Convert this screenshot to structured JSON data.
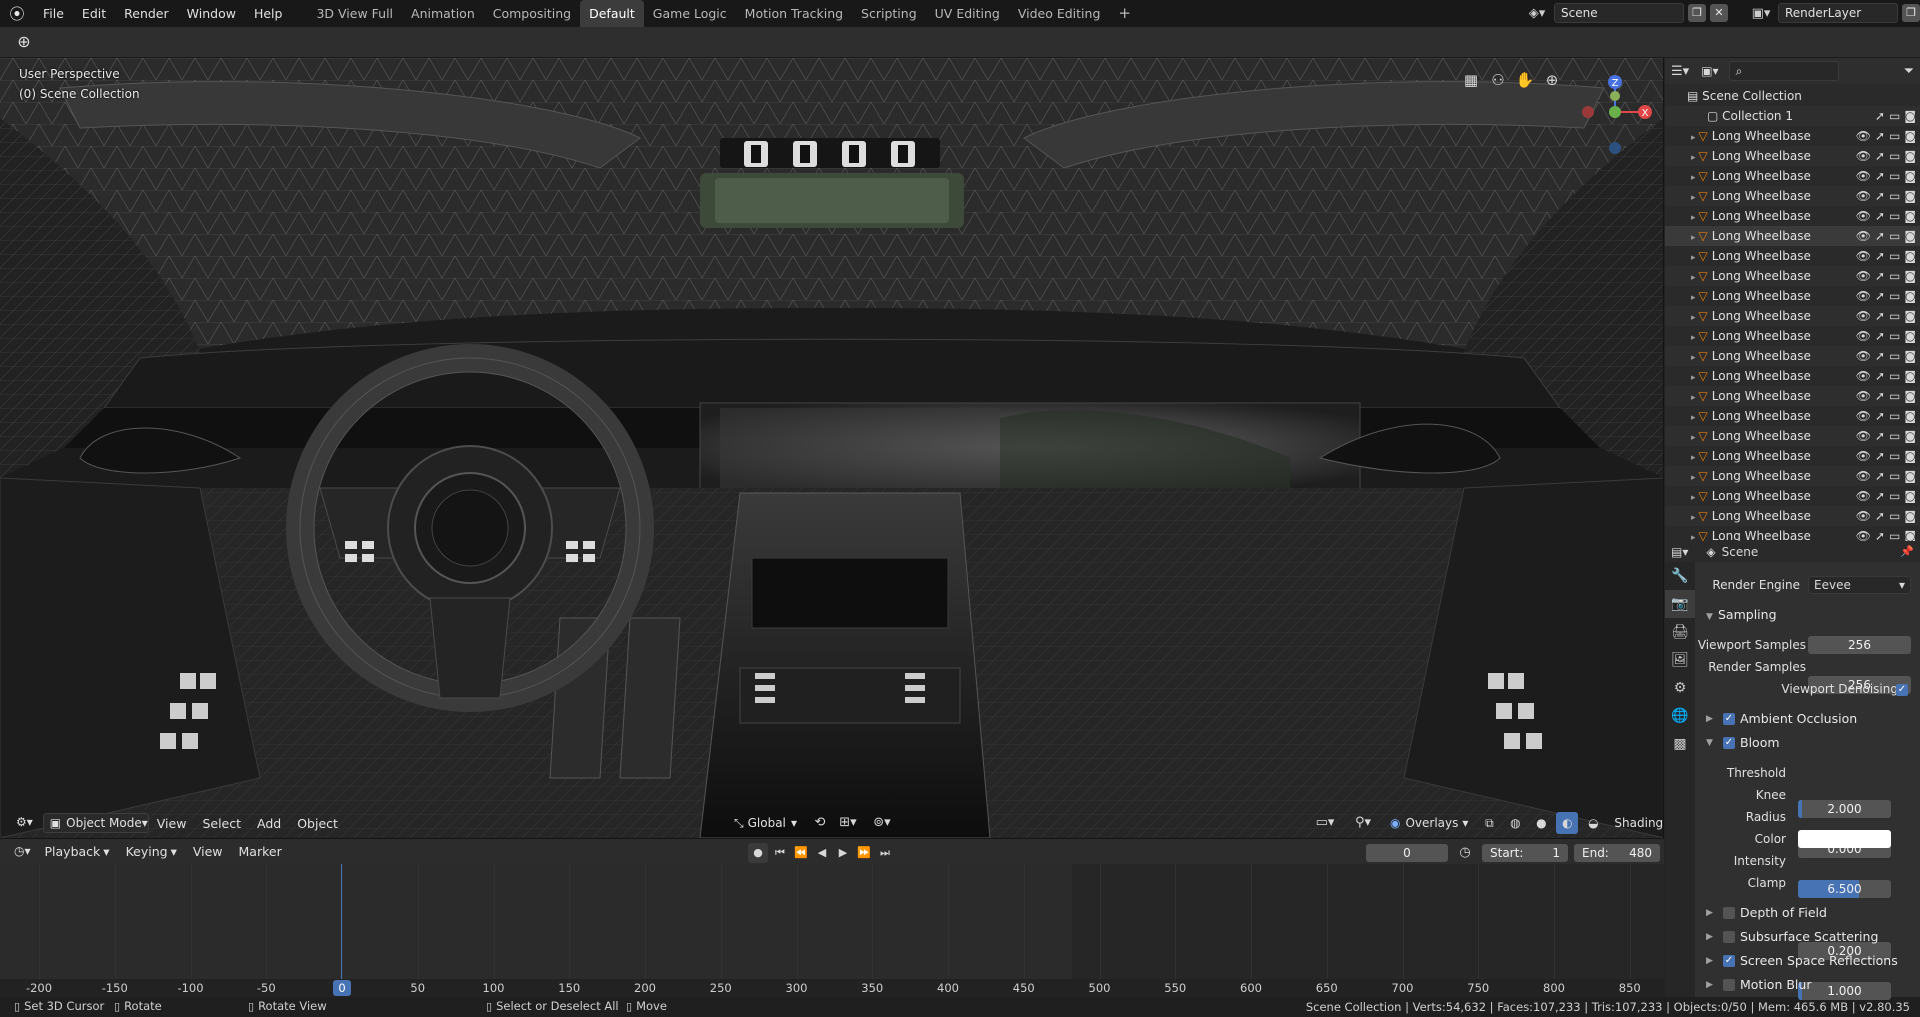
{
  "menu": [
    "File",
    "Edit",
    "Render",
    "Window",
    "Help"
  ],
  "workspaces": [
    "3D View Full",
    "Animation",
    "Compositing",
    "Default",
    "Game Logic",
    "Motion Tracking",
    "Scripting",
    "UV Editing",
    "Video Editing"
  ],
  "active_workspace": "Default",
  "add_workspace": "+",
  "scene_name": "Scene",
  "render_layer": "RenderLayer",
  "viewport": {
    "perspective": "User Perspective",
    "collection": "(0) Scene Collection",
    "mode": "Object Mode",
    "menus": [
      "View",
      "Select",
      "Add",
      "Object"
    ],
    "orientation": "Global",
    "overlays": "Overlays",
    "shading": "Shading",
    "gizmo": {
      "z": "Z",
      "x": "X"
    }
  },
  "timeline": {
    "menus": [
      "Playback",
      "Keying",
      "View",
      "Marker"
    ],
    "current_frame": "0",
    "start_label": "Start:",
    "start": "1",
    "end_label": "End:",
    "end": "480",
    "ruler": [
      "-200",
      "-150",
      "-100",
      "-50",
      "0",
      "50",
      "100",
      "150",
      "200",
      "250",
      "300",
      "350",
      "400",
      "450",
      "500",
      "550",
      "600",
      "650",
      "700",
      "750",
      "800",
      "850"
    ]
  },
  "status": {
    "items": [
      "Set 3D Cursor",
      "Rotate",
      "Rotate View",
      "Select or Deselect All",
      "Move"
    ],
    "stats": "Scene Collection | Verts:54,632 | Faces:107,233 | Tris:107,233 | Objects:0/50 | Mem: 465.6 MB | v2.80.35"
  },
  "outliner": {
    "root": "Scene Collection",
    "collection": "Collection 1",
    "object_label": "Long Wheelbase Car",
    "object_count": 21,
    "selected_index": 5
  },
  "properties": {
    "context": "Scene",
    "render_engine_label": "Render Engine",
    "render_engine": "Eevee",
    "sampling": "Sampling",
    "viewport_samples_label": "Viewport Samples",
    "viewport_samples": "256",
    "render_samples_label": "Render Samples",
    "render_samples": "256",
    "viewport_denoising": "Viewport Denoising",
    "ambient_occlusion": "Ambient Occlusion",
    "bloom": "Bloom",
    "threshold_label": "Threshold",
    "threshold": "2.000",
    "knee_label": "Knee",
    "knee": "0.000",
    "radius_label": "Radius",
    "radius": "6.500",
    "color_label": "Color",
    "intensity_label": "Intensity",
    "intensity": "0.200",
    "clamp_label": "Clamp",
    "clamp": "1.000",
    "depth_of_field": "Depth of Field",
    "subsurface_scattering": "Subsurface Scattering",
    "screen_space_reflections": "Screen Space Reflections",
    "motion_blur": "Motion Blur",
    "threshold_fill": 0.04,
    "radius_fill": 0.66,
    "clamp_fill": 0.04
  },
  "colors": {
    "accent": "#4772b3",
    "selection_orange": "#e87d0d"
  }
}
